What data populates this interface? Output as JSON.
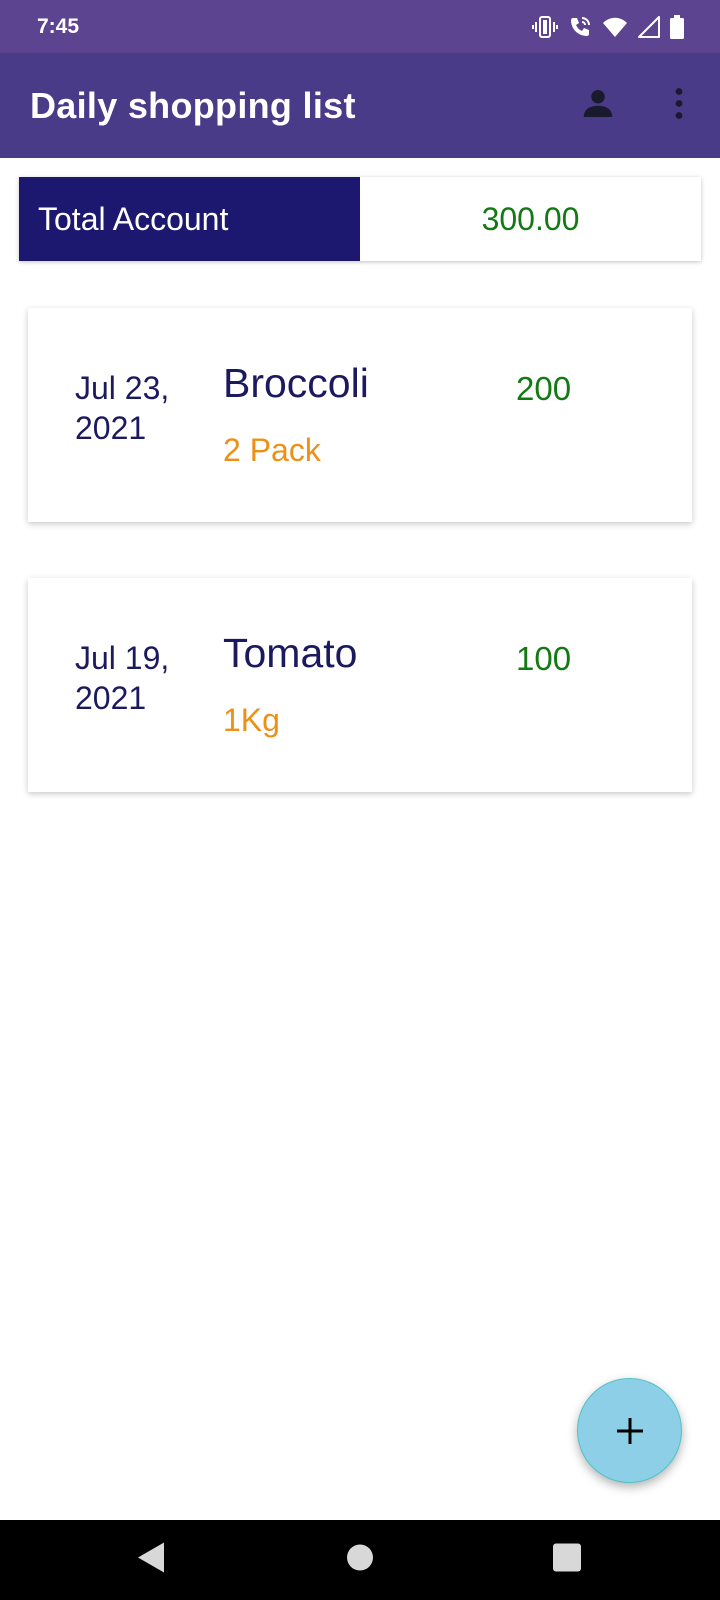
{
  "status_bar": {
    "time": "7:45",
    "icons": [
      "vibrate-icon",
      "wifi-call-icon",
      "wifi-icon",
      "signal-icon",
      "battery-icon"
    ]
  },
  "app_bar": {
    "title": "Daily shopping list",
    "actions": [
      "profile-icon",
      "more-vert-icon"
    ]
  },
  "total": {
    "label": "Total Account",
    "value": "300.00"
  },
  "items": [
    {
      "date": "Jul 23, 2021",
      "name": "Broccoli",
      "quantity": "2 Pack",
      "price": "200"
    },
    {
      "date": "Jul 19, 2021",
      "name": "Tomato",
      "quantity": "1Kg",
      "price": "100"
    }
  ],
  "fab": {
    "icon": "plus-icon"
  },
  "nav_bar": {
    "buttons": [
      "back-icon",
      "home-icon",
      "recents-icon"
    ]
  },
  "colors": {
    "status_bar": "#5c4491",
    "app_bar": "#4a3b88",
    "total_label_bg": "#1c1870",
    "price": "#137a13",
    "quantity": "#ee9016",
    "item_text": "#1c1a5e",
    "fab": "#8ecfe8"
  }
}
